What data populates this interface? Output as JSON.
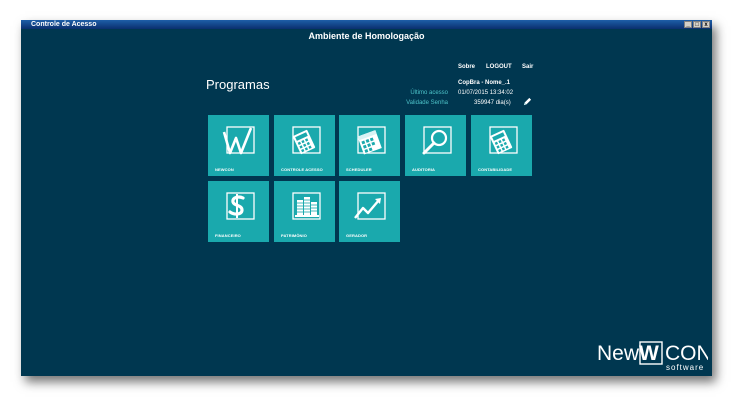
{
  "window": {
    "title": "Controle de Acesso",
    "controls": [
      "_",
      "□",
      "x"
    ]
  },
  "header": {
    "environment": "Ambiente de Homologação"
  },
  "nav": {
    "sobre": "Sobre",
    "logout": "LOGOUT",
    "sair": "Sair"
  },
  "page": {
    "title": "Programas"
  },
  "user": {
    "name": "CopBra - Nome_.1",
    "last_access_label": "Último acesso",
    "last_access_value": "01/07/2015 13:34:02",
    "password_validity_label": "Validade Senha",
    "password_validity_value": "359947 dia(s)"
  },
  "programs": [
    {
      "label": "NEWCON",
      "icon": "newcon-w-icon"
    },
    {
      "label": "CONTROLE ACESSO",
      "icon": "calculator-icon"
    },
    {
      "label": "SCHEDULER",
      "icon": "calendar-icon"
    },
    {
      "label": "AUDITORIA",
      "icon": "magnifier-icon"
    },
    {
      "label": "CONTABILIDADE",
      "icon": "calculator-icon"
    },
    {
      "label": "FINANCEIRO",
      "icon": "dollar-icon"
    },
    {
      "label": "PATRIMÔNIO",
      "icon": "stack-icon"
    },
    {
      "label": "GERADOR",
      "icon": "chart-line-icon"
    }
  ],
  "logo": {
    "brand_left": "New",
    "brand_mid": "W",
    "brand_right": "CON",
    "tagline": "software"
  },
  "colors": {
    "background": "#003750",
    "tile": "#1aa9ad",
    "accent_text": "#4cc3c9"
  }
}
